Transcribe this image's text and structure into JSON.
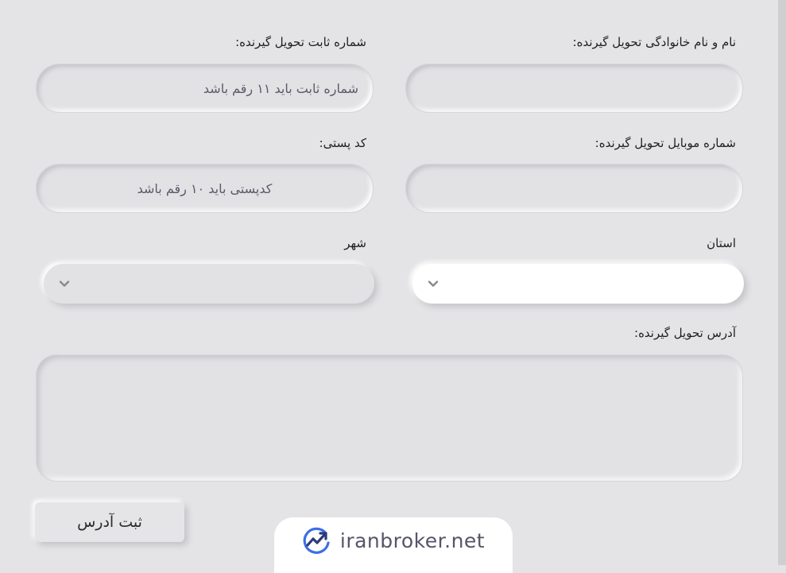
{
  "form": {
    "recipient_name_label": "نام و نام خانوادگی تحویل گیرنده:",
    "recipient_name_value": "",
    "landline_label": "شماره ثابت تحویل گیرنده:",
    "landline_placeholder": "شماره ثابت باید ۱۱ رقم باشد",
    "mobile_label": "شماره موبایل تحویل گیرنده:",
    "mobile_value": "",
    "postal_code_label": "کد پستی:",
    "postal_code_placeholder": "کدپستی باید ۱۰ رقم باشد",
    "province_label": "استان",
    "province_value": "",
    "city_label": "شهر",
    "city_value": "",
    "address_label": "آدرس تحویل گیرنده:",
    "address_value": "",
    "submit_label": "ثبت آدرس"
  },
  "icons": {
    "select_arrow": "chevron-down-icon",
    "watermark_logo": "trend-chart-icon"
  },
  "watermark": {
    "text": "iranbroker.net"
  },
  "colors": {
    "background": "#e4e4e6",
    "field_background": "#e2e2e4",
    "province_select_background": "#ffffff",
    "placeholder_text": "#5a5a6a",
    "logo_blue": "#3a6fe8",
    "logo_navy": "#2a3a7a"
  }
}
